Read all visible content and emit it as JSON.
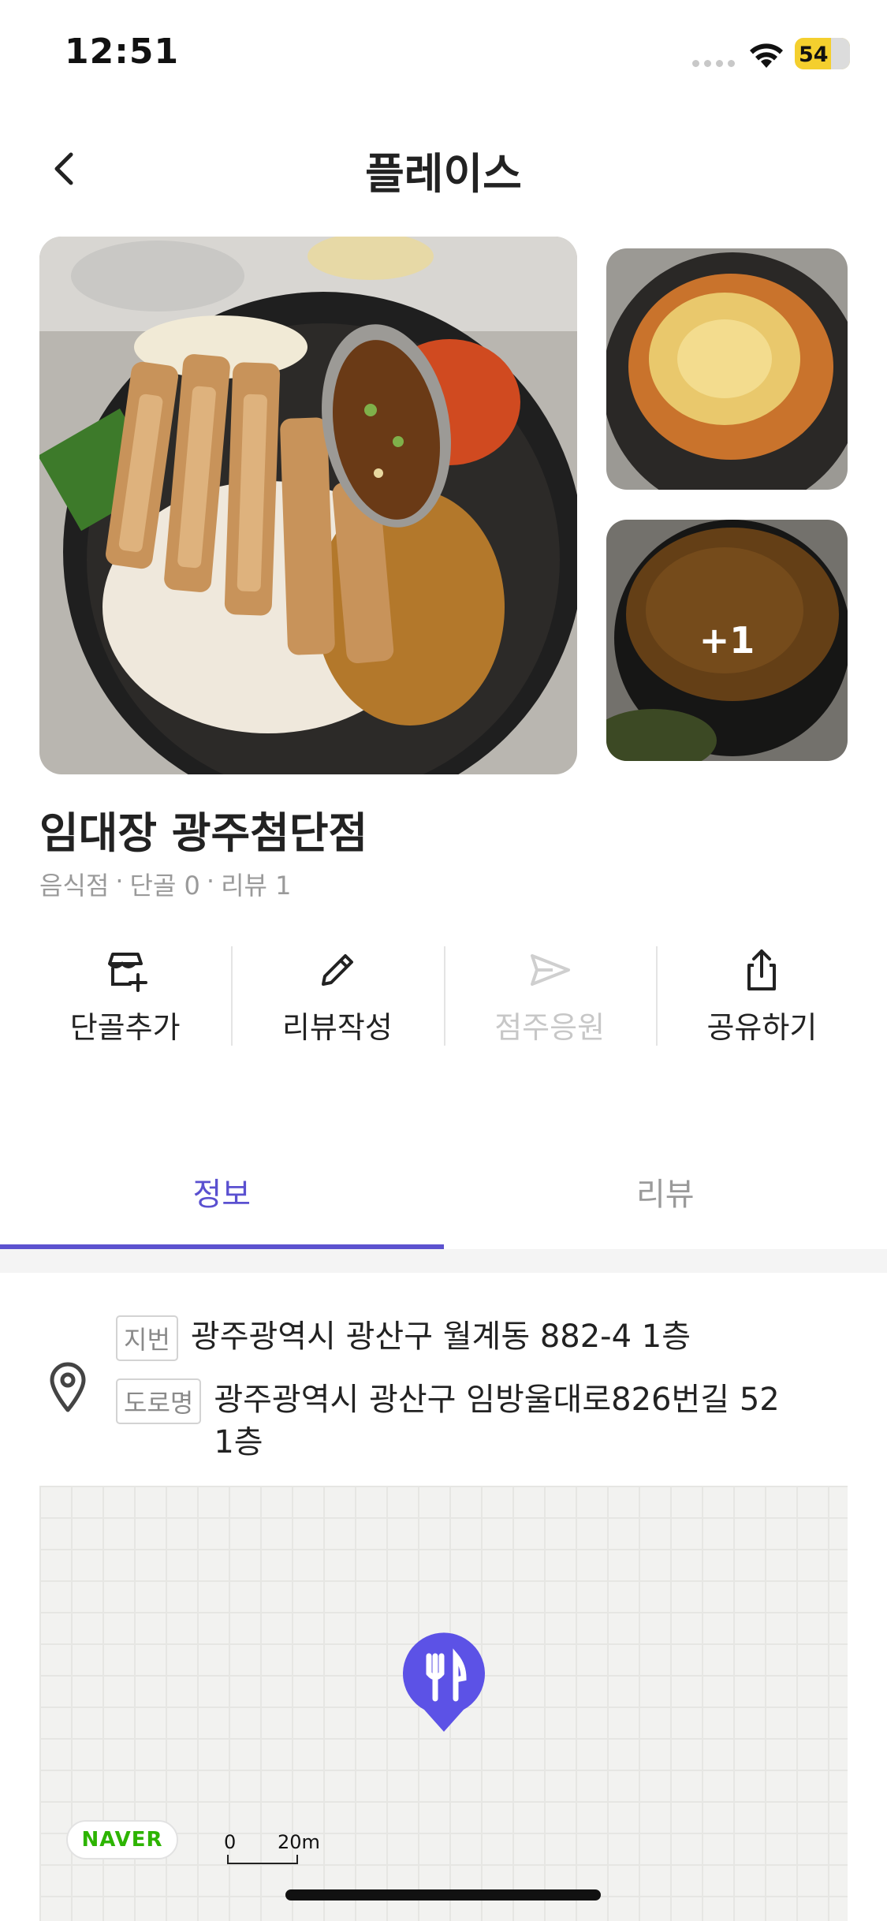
{
  "status_bar": {
    "time": "12:51",
    "battery": "54"
  },
  "header": {
    "title": "플레이스"
  },
  "photos": {
    "more_count": "+1"
  },
  "place": {
    "name": "임대장 광주첨단점",
    "category": "음식점",
    "regulars": "단골 0",
    "reviews": "리뷰 1",
    "separator": "·"
  },
  "actions": [
    {
      "label": "단골추가",
      "icon": "store-add-icon",
      "enabled": true
    },
    {
      "label": "리뷰작성",
      "icon": "pencil-icon",
      "enabled": true
    },
    {
      "label": "점주응원",
      "icon": "send-icon",
      "enabled": false
    },
    {
      "label": "공유하기",
      "icon": "share-icon",
      "enabled": true
    }
  ],
  "tabs": [
    {
      "label": "정보",
      "active": true
    },
    {
      "label": "리뷰",
      "active": false
    }
  ],
  "address": {
    "jibun_tag": "지번",
    "jibun": "광주광역시 광산구 월계동 882-4 1층",
    "road_tag": "도로명",
    "road": "광주광역시 광산구 임방울대로826번길 52 1층"
  },
  "map": {
    "provider": "NAVER",
    "scale_zero": "0",
    "scale_distance": "20m"
  },
  "colors": {
    "accent": "#5c52cf",
    "naver_green": "#2db400"
  }
}
